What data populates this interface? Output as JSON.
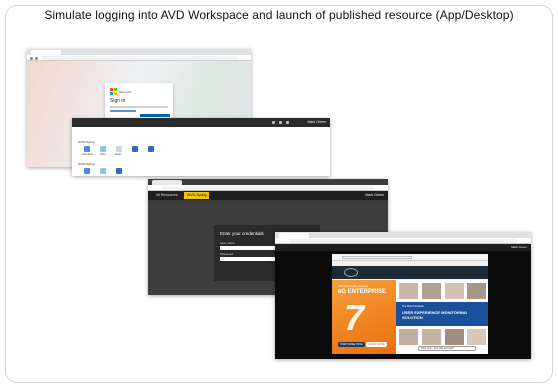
{
  "heading": "Simulate logging into AVD Workspace and launch of published resource (App/Desktop)",
  "signin": {
    "brand": "Microsoft",
    "title": "Sign in"
  },
  "workspace": {
    "user_label": "Mark Green",
    "groups": [
      "WVD-Spring",
      "WVD-Spring"
    ],
    "apps_group1": [
      "Calculator",
      "Paint",
      "Notes",
      "Remote Desktop",
      "Remote Desktop"
    ],
    "apps_group2": [
      "Calculator",
      "Paint",
      "WVD-Spring Desktop"
    ]
  },
  "credentials": {
    "tab_resources": "All Resources",
    "tab_workspace": "WVD-Spring",
    "user_label": "Mark Green",
    "title": "Enter your credentials",
    "username_label": "User name",
    "password_label": "Password"
  },
  "remote_app": {
    "user_label": "Mark Green",
    "hero_tag": "Introducing the Almost",
    "hero_brand": "eG ENTERPRISE",
    "banner_small": "The Most Complete",
    "banner_big": "USER EXPERIENCE MONITORING SOLUTION",
    "btn_primary": "START FREE TRIAL",
    "btn_secondary": "LEARN MORE",
    "chat_text": "Chat now - how can we help?"
  },
  "colors": {
    "ms_red": "#f25022",
    "ms_green": "#7fba00",
    "ms_blue": "#00a4ef",
    "ms_yellow": "#ffb900",
    "workspace_accent": "#f1c40f",
    "eg_orange": "#f0811f",
    "eg_blue": "#1a4f9c"
  }
}
